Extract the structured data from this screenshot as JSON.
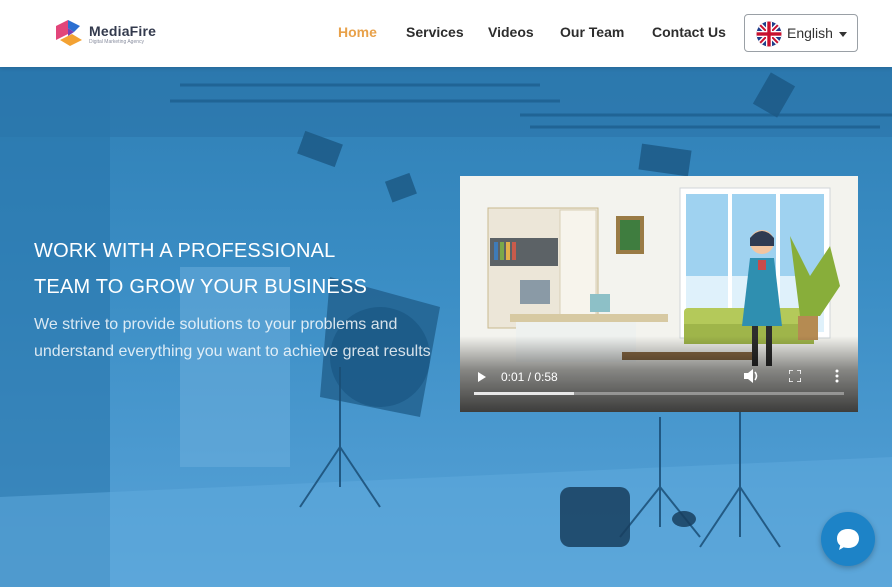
{
  "brand": {
    "name": "MediaFire",
    "tagline": "Digital Marketing Agency"
  },
  "nav": {
    "items": [
      {
        "label": "Home",
        "active": true
      },
      {
        "label": "Services",
        "active": false
      },
      {
        "label": "Videos",
        "active": false
      },
      {
        "label": "Our Team",
        "active": false
      },
      {
        "label": "Contact Us",
        "active": false
      }
    ],
    "language": {
      "label": "English",
      "flag": "uk-flag-icon"
    }
  },
  "hero": {
    "title_line1": "WORK WITH A PROFESSIONAL",
    "title_line2": "TEAM TO GROW YOUR BUSINESS",
    "subtitle": "We strive to provide solutions to your problems and understand everything you want to achieve great results"
  },
  "video": {
    "time": "0:01 / 0:58",
    "progress": 0.27,
    "controls": [
      "play-icon",
      "volume-icon",
      "fullscreen-icon",
      "more-options-icon"
    ]
  },
  "chat": {
    "icon": "chat-bubble-icon"
  },
  "colors": {
    "accent": "#e8a14a",
    "hero_blue": "#3a8dc4",
    "chat_blue": "#1d83c7",
    "nav_text": "#2d2d2d"
  }
}
